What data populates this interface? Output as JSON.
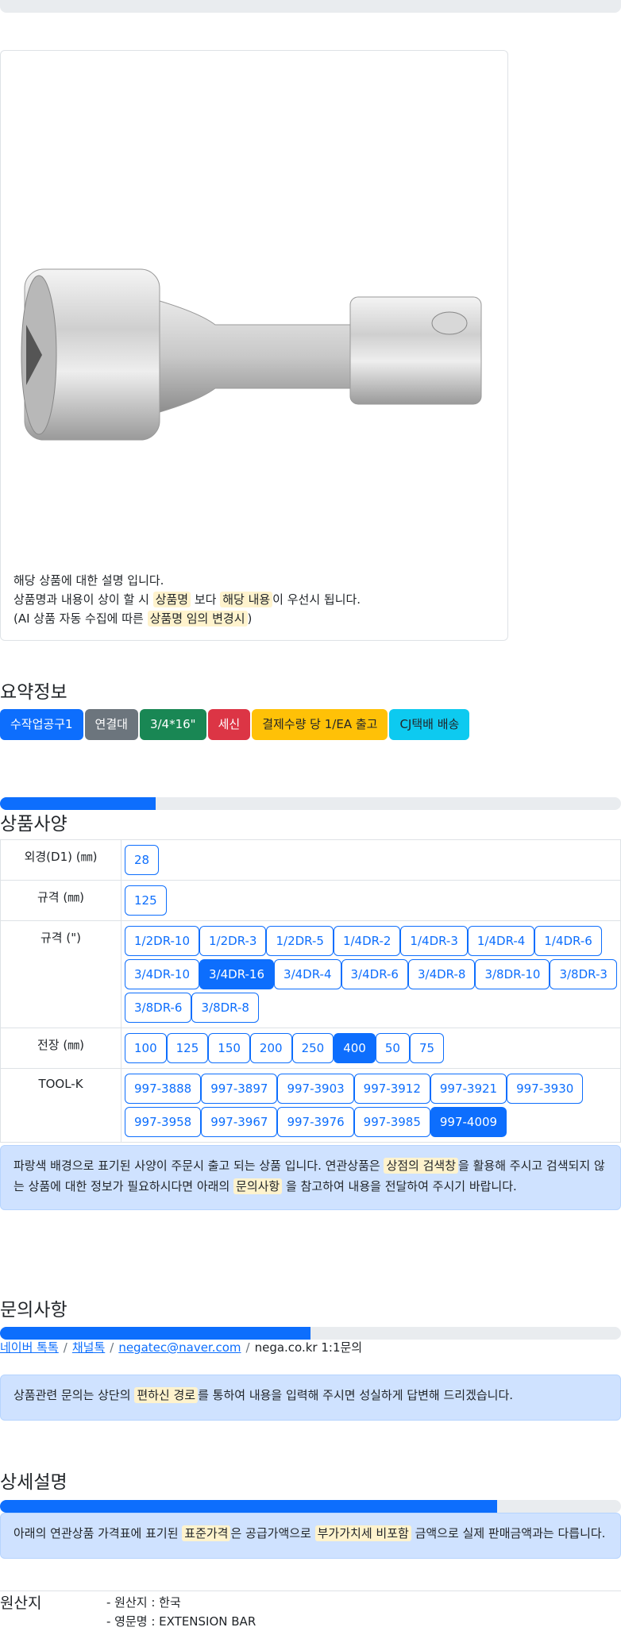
{
  "product": {
    "desc_line1": "해당 상품에 대한 설명 입니다.",
    "desc_line2_a": "상품명과 내용이 상이 할 시 ",
    "desc_line2_hl1": "상품명",
    "desc_line2_b": " 보다 ",
    "desc_line2_hl2": "해당 내용",
    "desc_line2_c": "이 우선시 됩니다.",
    "desc_line3_a": "(AI 상품 자동 수집에 따른 ",
    "desc_line3_hl": "상품명 임의 변경시",
    "desc_line3_b": ")"
  },
  "summary": {
    "title": "요약정보",
    "badges": [
      {
        "label": "수작업공구1",
        "color": "#0d6efd"
      },
      {
        "label": "연결대",
        "color": "#6c757d"
      },
      {
        "label": "3/4*16\"",
        "color": "#198754"
      },
      {
        "label": "세신",
        "color": "#dc3545"
      },
      {
        "label": "결제수량 당 1/EA 출고",
        "color": "#ffc107"
      },
      {
        "label": "CJ택배 배송",
        "color": "#0dcaf0"
      }
    ]
  },
  "spec": {
    "title": "상품사양",
    "progress": 0.25,
    "rows": [
      {
        "label": "외경(D1) (㎜)",
        "options": [
          "28"
        ]
      },
      {
        "label": "규격 (㎜)",
        "options": [
          "125"
        ]
      },
      {
        "label": "규격 (\")",
        "options": [
          "1/2DR-10",
          "1/2DR-3",
          "1/2DR-5",
          "1/4DR-2",
          "1/4DR-3",
          "1/4DR-4",
          "1/4DR-6",
          "3/4DR-10",
          "3/4DR-16",
          "3/4DR-4",
          "3/4DR-6",
          "3/4DR-8",
          "3/8DR-10",
          "3/8DR-3",
          "3/8DR-6",
          "3/8DR-8"
        ],
        "selected": "3/4DR-16"
      },
      {
        "label": "전장 (㎜)",
        "options": [
          "100",
          "125",
          "150",
          "200",
          "250",
          "400",
          "50",
          "75"
        ],
        "selected": "400"
      },
      {
        "label": "TOOL-K",
        "options": [
          "997-3888",
          "997-3897",
          "997-3903",
          "997-3912",
          "997-3921",
          "997-3930",
          "997-3958",
          "997-3967",
          "997-3976",
          "997-3985",
          "997-4009"
        ],
        "selected": "997-4009"
      }
    ],
    "notice_a": "파랑색 배경으로 표기된 사양이 주문시 출고 되는 상품 입니다. 연관상품은 ",
    "notice_hl1": "상점의 검색창",
    "notice_b": "을 활용해 주시고 검색되지 않는 상품에 대한 정보가 필요하시다면 아래의 ",
    "notice_hl2": "문의사항",
    "notice_c": " 을 참고하여 내용을 전달하여 주시기 바랍니다."
  },
  "inquiry": {
    "title": "문의사항",
    "progress": 0.5,
    "link1": "네이버 톡톡",
    "link2": "채널톡",
    "link3": "negatec@naver.com",
    "sep": "/",
    "plain": "nega.co.kr 1:1문의",
    "notice_a": "상품관련 문의는 상단의 ",
    "notice_hl": "편하신 경로",
    "notice_b": "를 통하여 내용을 입력해 주시면 성실하게 답변해 드리겠습니다."
  },
  "detail": {
    "title": "상세설명",
    "progress": 0.8,
    "notice_a": "아래의 연관상품 가격표에 표기된 ",
    "notice_hl1": "표준가격",
    "notice_b": "은 공급가액으로 ",
    "notice_hl2": "부가가치세 비포함",
    "notice_c": " 금액으로 실제 판매금액과는 다릅니다."
  },
  "origin": {
    "label": "원산지",
    "item1": "- 원산지 : 한국",
    "item2": "- 영문명 : EXTENSION BAR"
  }
}
